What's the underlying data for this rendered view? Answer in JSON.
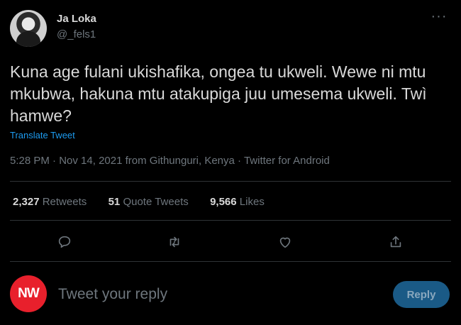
{
  "author": {
    "display_name": "Ja Loka",
    "handle": "@_fels1",
    "avatar_icon": "user-avatar"
  },
  "tweet": {
    "text": "Kuna age fulani ukishafika, ongea tu ukweli. Wewe ni mtu mkubwa, hakuna mtu atakupiga juu umesema ukweli. Twì hamwe?",
    "translate_label": "Translate Tweet",
    "time": "5:28 PM",
    "date": "Nov 14, 2021",
    "location": "from Githunguri, Kenya",
    "source": "Twitter for Android"
  },
  "stats": {
    "retweets_count": "2,327",
    "retweets_label": "Retweets",
    "quote_count": "51",
    "quote_label": "Quote Tweets",
    "likes_count": "9,566",
    "likes_label": "Likes"
  },
  "actions": [
    {
      "name": "reply-icon"
    },
    {
      "name": "retweet-icon"
    },
    {
      "name": "like-icon"
    },
    {
      "name": "share-icon"
    }
  ],
  "reply_box": {
    "avatar_text": "NW",
    "placeholder": "Tweet your reply",
    "button_label": "Reply"
  },
  "colors": {
    "background": "#000000",
    "text_primary": "#d9d9d9",
    "text_secondary": "#6e767d",
    "link": "#1d9bf0",
    "divider": "#2f3336",
    "reply_button": "#1a5a86",
    "reply_avatar": "#e8202c"
  }
}
